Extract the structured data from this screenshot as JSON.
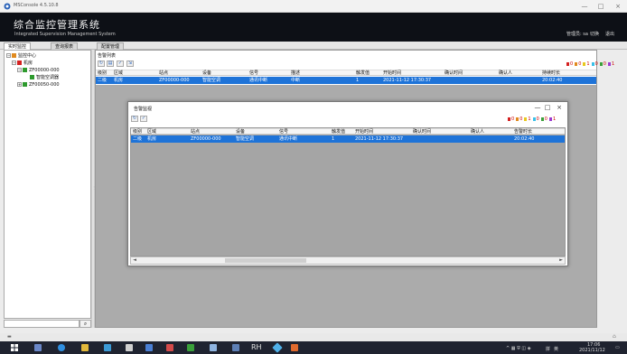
{
  "window": {
    "title": "MSConsole 4.5.10.8",
    "controls": {
      "minimize": "—",
      "maximize": "□",
      "close": "×"
    }
  },
  "banner": {
    "title": "综合监控管理系统",
    "subtitle": "Integrated Supervision Management System",
    "user_links": [
      "管理员: sa",
      "切换",
      "退出"
    ]
  },
  "tabs": [
    {
      "label": "实时监控",
      "active": true
    },
    {
      "label": "查询报表",
      "active": false
    },
    {
      "label": "配置管理",
      "active": false
    }
  ],
  "tree": {
    "nodes": [
      {
        "label": "监控中心",
        "level": 0,
        "expander": "−",
        "icon_color": "#e08a1e"
      },
      {
        "label": "机房",
        "level": 1,
        "expander": "−",
        "icon_color": "#d42020"
      },
      {
        "label": "ZF00000-000",
        "level": 2,
        "expander": "−",
        "icon_color": "#2e9a2e"
      },
      {
        "label": "智能空调器",
        "level": 3,
        "expander": "",
        "icon_color": "#2e9a2e"
      },
      {
        "label": "ZF00050-000",
        "level": 2,
        "expander": "+",
        "icon_color": "#2e9a2e"
      }
    ],
    "search_placeholder": "",
    "search_icon": "magnifier-icon"
  },
  "alarm_list": {
    "title": "告警列表",
    "toolbar": [
      {
        "icon": "refresh-icon"
      },
      {
        "icon": "filter-icon"
      },
      {
        "icon": "confirm-icon"
      },
      {
        "icon": "export-icon"
      }
    ],
    "counters": [
      {
        "color": "#d42020",
        "value": "0"
      },
      {
        "color": "#e08a1e",
        "value": "0"
      },
      {
        "color": "#e8c81e",
        "value": "1"
      },
      {
        "color": "#39c0e8",
        "value": "0"
      },
      {
        "color": "#3aa03a",
        "value": "0"
      },
      {
        "color": "#9b3ad0",
        "value": "1"
      }
    ],
    "columns": [
      "级别",
      "区域",
      "站点",
      "设备",
      "信号",
      "描述",
      "触发值",
      "开始时间",
      "确认时间",
      "确认人",
      "持续时长"
    ],
    "rows": [
      [
        "二级",
        "机房",
        "ZF00000-000",
        "智能空调",
        "通讯中断",
        "中断",
        "1",
        "2021-11-12 17:30:37",
        "",
        "",
        "20:02:40"
      ]
    ]
  },
  "popup": {
    "title": "告警监视",
    "controls": {
      "minimize": "—",
      "maximize": "□",
      "close": "×"
    },
    "toolbar": [
      {
        "icon": "refresh-icon"
      },
      {
        "icon": "confirm-icon"
      }
    ],
    "counters": [
      {
        "color": "#d42020",
        "value": "0"
      },
      {
        "color": "#e08a1e",
        "value": "0"
      },
      {
        "color": "#e8c81e",
        "value": "1"
      },
      {
        "color": "#39c0e8",
        "value": "0"
      },
      {
        "color": "#3aa03a",
        "value": "0"
      },
      {
        "color": "#9b3ad0",
        "value": "1"
      }
    ],
    "columns": [
      "级别",
      "区域",
      "站点",
      "设备",
      "信号",
      "触发值",
      "开始时间",
      "确认时间",
      "确认人",
      "告警时长"
    ],
    "rows": [
      [
        "二级",
        "机房",
        "ZF00000-000",
        "智能空调",
        "通讯中断",
        "1",
        "2021-11-12 17:30:37",
        "",
        "",
        "20:02:40"
      ]
    ],
    "scroll": {
      "left": "◄",
      "right": "►"
    }
  },
  "taskbar": {
    "text_item": "RH",
    "tray_lang": "英",
    "tray_ime": "拼",
    "time": "17:06",
    "date": "2021/11/12"
  },
  "colors": {
    "selection": "#1e73d8",
    "banner": "#0d1016",
    "grid_bg": "#ababab"
  }
}
